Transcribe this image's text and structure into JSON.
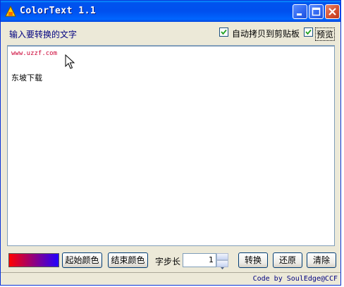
{
  "window": {
    "title": "ColorText 1.1",
    "title_bar_color": "#0053ee"
  },
  "header": {
    "input_label": "输入要转换的文字",
    "auto_copy": {
      "label": "自动拷贝到剪贴板",
      "checked": true
    },
    "preview": {
      "label": "预览",
      "checked": true
    }
  },
  "editor": {
    "lines": [
      "www.uzzf.com",
      "东坡下载"
    ],
    "first_line_color": "#cc0033"
  },
  "toolbar": {
    "gradient_start": "#ff0000",
    "gradient_end": "#2200ff",
    "start_color_label": "起始颜色",
    "end_color_label": "结束颜色",
    "step_label": "字步长",
    "step_value": "1",
    "convert_label": "转换",
    "restore_label": "还原",
    "clear_label": "清除"
  },
  "status": {
    "credit": "Code by SoulEdge@CCF"
  },
  "icons": [
    "app-icon",
    "minimize-icon",
    "maximize-icon",
    "close-icon",
    "checkmark-icon",
    "spin-up-icon",
    "spin-down-icon",
    "mouse-cursor-icon"
  ]
}
